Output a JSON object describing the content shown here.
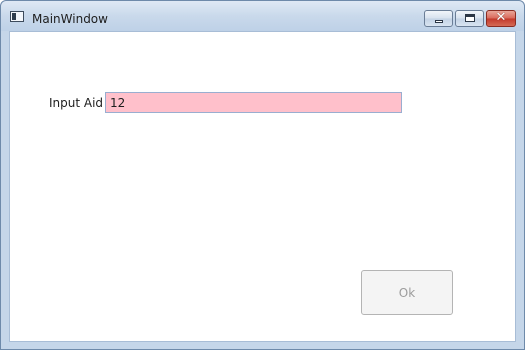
{
  "window": {
    "title": "MainWindow",
    "controls": {
      "minimize": "minimize",
      "maximize": "maximize",
      "close": "✕"
    }
  },
  "form": {
    "input_label": "Input Aid",
    "input_value": "12",
    "input_background": "#ffc0cb",
    "ok_label": "Ok",
    "ok_enabled": false
  }
}
